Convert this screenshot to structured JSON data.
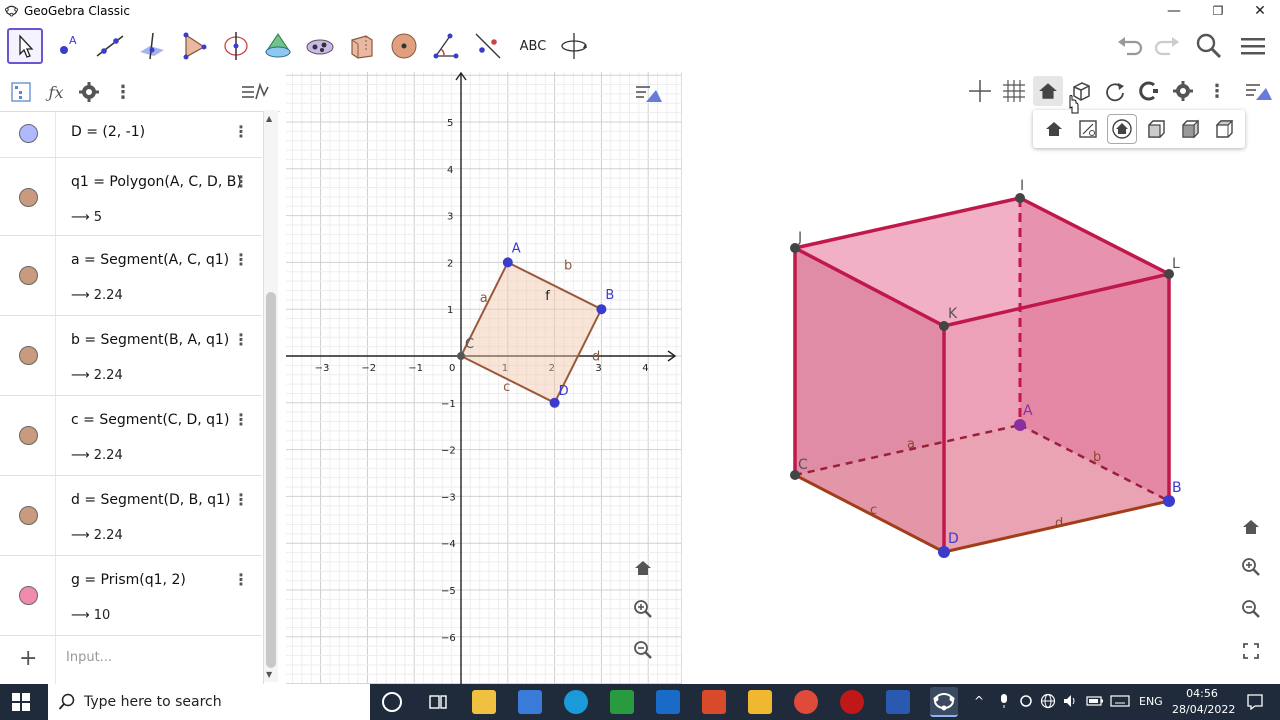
{
  "window": {
    "title": "GeoGebra Classic",
    "minimize": "—",
    "maximize": "❐",
    "close": "✕"
  },
  "toolbar": {
    "text_tool_label": "ABC",
    "accent": "#6557d2"
  },
  "algebra": {
    "rows": [
      {
        "expr": "D = (2, -1)",
        "value": "",
        "color": "#b0b8ff"
      },
      {
        "expr": "q1 = Polygon(A, C, D, B)",
        "value": "⟶ 5",
        "color": "#c99a7e"
      },
      {
        "expr": "a = Segment(A, C, q1)",
        "value": "⟶ 2.24",
        "color": "#c99a7e"
      },
      {
        "expr": "b = Segment(B, A, q1)",
        "value": "⟶ 2.24",
        "color": "#c99a7e"
      },
      {
        "expr": "c = Segment(C, D, q1)",
        "value": "⟶ 2.24",
        "color": "#c99a7e"
      },
      {
        "expr": "d = Segment(D, B, q1)",
        "value": "⟶ 2.24",
        "color": "#c99a7e"
      },
      {
        "expr": "g = Prism(q1, 2)",
        "value": "⟶ 10",
        "color": "#f08cab"
      }
    ],
    "input_placeholder": "Input...",
    "add_label": "+"
  },
  "graphics2d": {
    "x_ticks": [
      "−3",
      "−2",
      "−1",
      "0",
      "1",
      "2",
      "3",
      "4"
    ],
    "y_ticks": [
      "5",
      "4",
      "3",
      "2",
      "1",
      "−1",
      "−2",
      "−3",
      "−4",
      "−5",
      "−6"
    ],
    "points": [
      {
        "name": "A",
        "x": 1,
        "y": 2
      },
      {
        "name": "B",
        "x": 3,
        "y": 1
      },
      {
        "name": "C",
        "x": 0,
        "y": 0
      },
      {
        "name": "D",
        "x": 2,
        "y": -1
      }
    ],
    "segment_labels": [
      "a",
      "b",
      "c",
      "d",
      "f"
    ]
  },
  "graphics3d": {
    "point_labels": [
      "J",
      "I",
      "L",
      "K",
      "A",
      "C",
      "B",
      "D"
    ],
    "edge_labels": [
      "a",
      "b",
      "c",
      "d"
    ]
  },
  "taskbar": {
    "search_placeholder": "Type here to search",
    "lang": "ENG",
    "time": "04:56",
    "date": "28/04/2022"
  }
}
